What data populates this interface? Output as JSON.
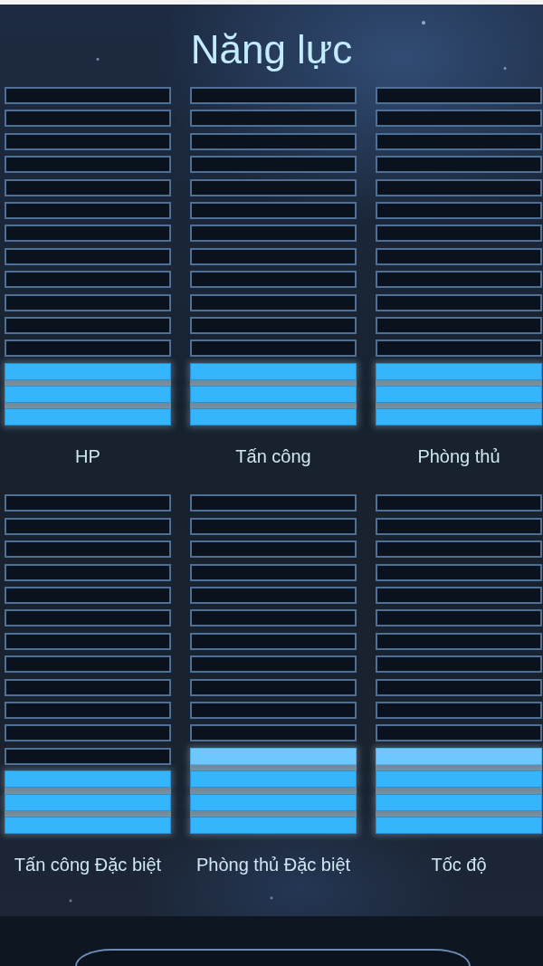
{
  "title": "Năng lực",
  "stats": [
    {
      "label": "HP",
      "segments": [
        {
          "filled": false,
          "highlighted": false
        },
        {
          "filled": false,
          "highlighted": false
        },
        {
          "filled": false,
          "highlighted": false
        },
        {
          "filled": false,
          "highlighted": false
        },
        {
          "filled": false,
          "highlighted": false
        },
        {
          "filled": false,
          "highlighted": false
        },
        {
          "filled": false,
          "highlighted": false
        },
        {
          "filled": false,
          "highlighted": false
        },
        {
          "filled": false,
          "highlighted": false
        },
        {
          "filled": false,
          "highlighted": false
        },
        {
          "filled": false,
          "highlighted": false
        },
        {
          "filled": false,
          "highlighted": false
        },
        {
          "filled": true,
          "highlighted": false
        },
        {
          "filled": true,
          "highlighted": false
        },
        {
          "filled": true,
          "highlighted": false
        }
      ]
    },
    {
      "label": "Tấn công",
      "segments": [
        {
          "filled": false,
          "highlighted": false
        },
        {
          "filled": false,
          "highlighted": false
        },
        {
          "filled": false,
          "highlighted": false
        },
        {
          "filled": false,
          "highlighted": false
        },
        {
          "filled": false,
          "highlighted": false
        },
        {
          "filled": false,
          "highlighted": false
        },
        {
          "filled": false,
          "highlighted": false
        },
        {
          "filled": false,
          "highlighted": false
        },
        {
          "filled": false,
          "highlighted": false
        },
        {
          "filled": false,
          "highlighted": false
        },
        {
          "filled": false,
          "highlighted": false
        },
        {
          "filled": false,
          "highlighted": false
        },
        {
          "filled": true,
          "highlighted": false
        },
        {
          "filled": true,
          "highlighted": false
        },
        {
          "filled": true,
          "highlighted": false
        }
      ]
    },
    {
      "label": "Phòng thủ",
      "segments": [
        {
          "filled": false,
          "highlighted": false
        },
        {
          "filled": false,
          "highlighted": false
        },
        {
          "filled": false,
          "highlighted": false
        },
        {
          "filled": false,
          "highlighted": false
        },
        {
          "filled": false,
          "highlighted": false
        },
        {
          "filled": false,
          "highlighted": false
        },
        {
          "filled": false,
          "highlighted": false
        },
        {
          "filled": false,
          "highlighted": false
        },
        {
          "filled": false,
          "highlighted": false
        },
        {
          "filled": false,
          "highlighted": false
        },
        {
          "filled": false,
          "highlighted": false
        },
        {
          "filled": false,
          "highlighted": false
        },
        {
          "filled": true,
          "highlighted": false
        },
        {
          "filled": true,
          "highlighted": false
        },
        {
          "filled": true,
          "highlighted": false
        }
      ]
    },
    {
      "label": "Tấn công Đặc biệt",
      "segments": [
        {
          "filled": false,
          "highlighted": false
        },
        {
          "filled": false,
          "highlighted": false
        },
        {
          "filled": false,
          "highlighted": false
        },
        {
          "filled": false,
          "highlighted": false
        },
        {
          "filled": false,
          "highlighted": false
        },
        {
          "filled": false,
          "highlighted": false
        },
        {
          "filled": false,
          "highlighted": false
        },
        {
          "filled": false,
          "highlighted": false
        },
        {
          "filled": false,
          "highlighted": false
        },
        {
          "filled": false,
          "highlighted": false
        },
        {
          "filled": false,
          "highlighted": false
        },
        {
          "filled": false,
          "highlighted": false
        },
        {
          "filled": true,
          "highlighted": false
        },
        {
          "filled": true,
          "highlighted": false
        },
        {
          "filled": true,
          "highlighted": false
        }
      ]
    },
    {
      "label": "Phòng thủ Đặc biệt",
      "segments": [
        {
          "filled": false,
          "highlighted": false
        },
        {
          "filled": false,
          "highlighted": false
        },
        {
          "filled": false,
          "highlighted": false
        },
        {
          "filled": false,
          "highlighted": false
        },
        {
          "filled": false,
          "highlighted": false
        },
        {
          "filled": false,
          "highlighted": false
        },
        {
          "filled": false,
          "highlighted": false
        },
        {
          "filled": false,
          "highlighted": false
        },
        {
          "filled": false,
          "highlighted": false
        },
        {
          "filled": false,
          "highlighted": false
        },
        {
          "filled": false,
          "highlighted": false
        },
        {
          "filled": true,
          "highlighted": true
        },
        {
          "filled": true,
          "highlighted": false
        },
        {
          "filled": true,
          "highlighted": false
        },
        {
          "filled": true,
          "highlighted": false
        }
      ]
    },
    {
      "label": "Tốc độ",
      "segments": [
        {
          "filled": false,
          "highlighted": false
        },
        {
          "filled": false,
          "highlighted": false
        },
        {
          "filled": false,
          "highlighted": false
        },
        {
          "filled": false,
          "highlighted": false
        },
        {
          "filled": false,
          "highlighted": false
        },
        {
          "filled": false,
          "highlighted": false
        },
        {
          "filled": false,
          "highlighted": false
        },
        {
          "filled": false,
          "highlighted": false
        },
        {
          "filled": false,
          "highlighted": false
        },
        {
          "filled": false,
          "highlighted": false
        },
        {
          "filled": false,
          "highlighted": false
        },
        {
          "filled": true,
          "highlighted": true
        },
        {
          "filled": true,
          "highlighted": false
        },
        {
          "filled": true,
          "highlighted": false
        },
        {
          "filled": true,
          "highlighted": false
        }
      ]
    }
  ]
}
